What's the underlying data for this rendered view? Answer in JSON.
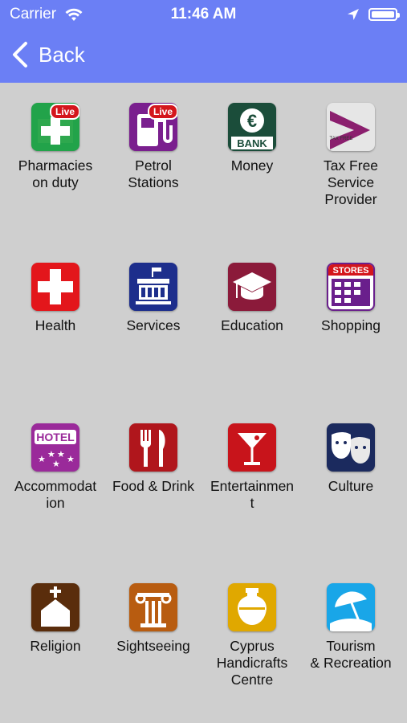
{
  "status_bar": {
    "carrier": "Carrier",
    "time": "11:46 AM"
  },
  "nav": {
    "back_label": "Back"
  },
  "badge": {
    "live": "Live"
  },
  "icon_text": {
    "bank": "BANK",
    "tax_free": "TAX FREE",
    "stores": "STORES",
    "hotel": "HOTEL"
  },
  "tiles": [
    {
      "label": "Pharmacies\non duty",
      "icon": "pharmacy-live-icon"
    },
    {
      "label": "Petrol\nStations",
      "icon": "petrol-live-icon"
    },
    {
      "label": "Money",
      "icon": "bank-euro-icon"
    },
    {
      "label": "Tax Free\nService\nProvider",
      "icon": "tax-free-icon"
    },
    {
      "label": "Health",
      "icon": "health-cross-icon"
    },
    {
      "label": "Services",
      "icon": "services-building-icon"
    },
    {
      "label": "Education",
      "icon": "graduation-cap-icon"
    },
    {
      "label": "Shopping",
      "icon": "stores-icon"
    },
    {
      "label": "Accommodat\nion",
      "icon": "hotel-icon"
    },
    {
      "label": "Food & Drink",
      "icon": "fork-knife-icon"
    },
    {
      "label": "Entertainmen\nt",
      "icon": "cocktail-icon"
    },
    {
      "label": "Culture",
      "icon": "theatre-masks-icon"
    },
    {
      "label": "Religion",
      "icon": "church-icon"
    },
    {
      "label": "Sightseeing",
      "icon": "column-icon"
    },
    {
      "label": "Cyprus\nHandicrafts\nCentre",
      "icon": "vase-icon"
    },
    {
      "label": "Tourism\n& Recreation",
      "icon": "beach-umbrella-icon"
    }
  ]
}
